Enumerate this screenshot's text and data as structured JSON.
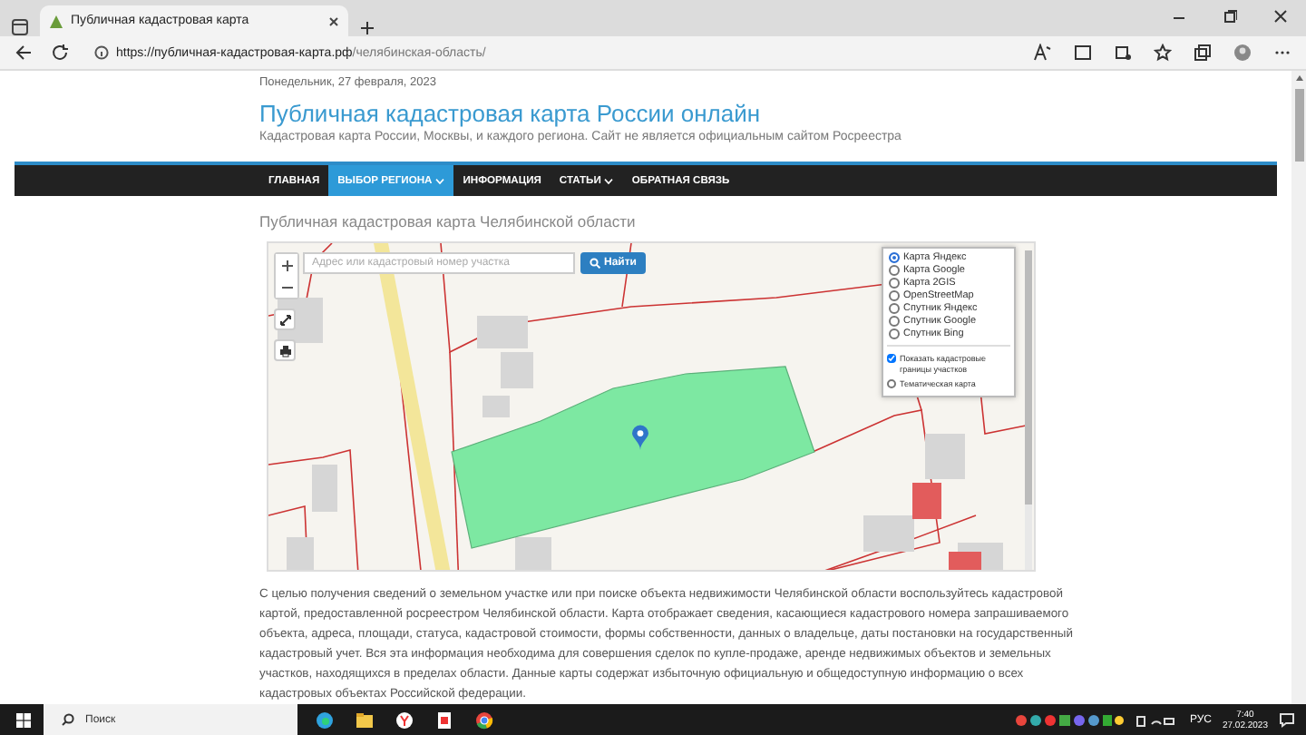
{
  "browser": {
    "tab_title": "Публичная кадастровая карта",
    "url_host": "https://публичная-кадастровая-карта.рф",
    "url_path": "/челябинская-область/"
  },
  "site": {
    "date": "Понедельник, 27 февраля, 2023",
    "title": "Публичная кадастровая карта России онлайн",
    "subtitle": "Кадастровая карта России, Москвы, и каждого региона. Сайт не является официальным сайтом Росреестра",
    "nav": [
      {
        "label": "ГЛАВНАЯ",
        "selected": false,
        "dropdown": false
      },
      {
        "label": "ВЫБОР РЕГИОНА",
        "selected": true,
        "dropdown": true
      },
      {
        "label": "ИНФОРМАЦИЯ",
        "selected": false,
        "dropdown": false
      },
      {
        "label": "СТАТЬИ",
        "selected": false,
        "dropdown": true
      },
      {
        "label": "ОБРАТНАЯ СВЯЗЬ",
        "selected": false,
        "dropdown": false
      }
    ],
    "heading": "Публичная кадастровая карта Челябинской области"
  },
  "map": {
    "search": {
      "placeholder": "Адрес или кадастровый номер участка",
      "button": "Найти"
    },
    "layers": [
      {
        "label": "Карта Яндекс",
        "selected": true
      },
      {
        "label": "Карта Google",
        "selected": false
      },
      {
        "label": "Карта 2GIS",
        "selected": false
      },
      {
        "label": "OpenStreetMap",
        "selected": false
      },
      {
        "label": "Спутник Яндекс",
        "selected": false
      },
      {
        "label": "Спутник Google",
        "selected": false
      },
      {
        "label": "Спутник Bing",
        "selected": false
      }
    ],
    "options": [
      {
        "label": "Показать кадастровые границы участков",
        "checked": true
      },
      {
        "label": "Тематическая карта",
        "checked": false
      }
    ]
  },
  "description": "С целью получения сведений о земельном участке или при поиске объекта недвижимости Челябинской области воспользуйтесь кадастровой картой, предоставленной росреестром Челябинской области. Карта отображает сведения, касающиеся кадастрового номера запрашиваемого объекта, адреса, площади, статуса, кадастровой стоимости, формы собственности, данных о владельце, даты постановки на государственный кадастровый учет. Вся эта информация необходима для совершения сделок по купле-продаже, аренде недвижимых объектов и земельных участков, находящихся в пределах области. Данные карты содержат избыточную официальную и общедоступную информацию о всех кадастровых объектах Российской федерации.",
  "taskbar": {
    "search": "Поиск",
    "language": "РУС",
    "time": "7:40",
    "date": "27.02.2023"
  }
}
